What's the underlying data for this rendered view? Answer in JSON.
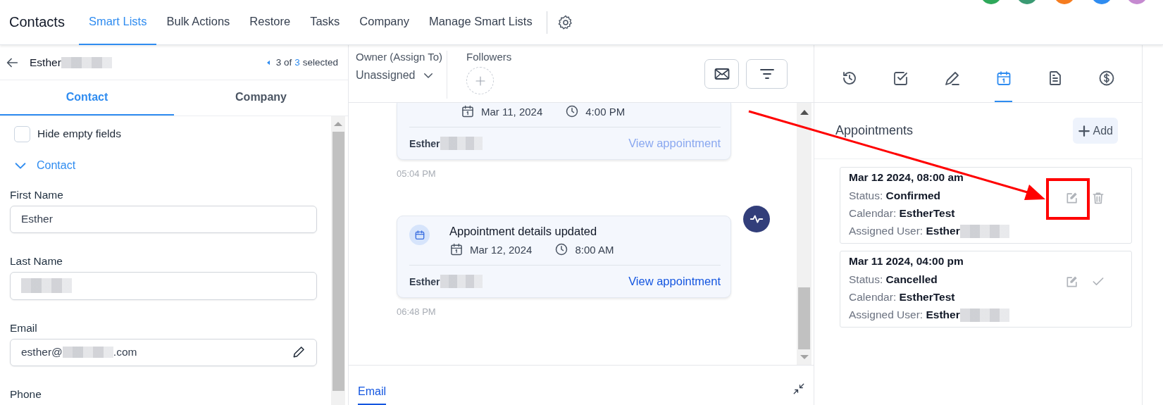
{
  "top_bar": {
    "title": "Contacts",
    "tabs": [
      {
        "label": "Smart Lists",
        "selected": true
      },
      {
        "label": "Bulk Actions",
        "selected": false
      },
      {
        "label": "Restore",
        "selected": false
      },
      {
        "label": "Tasks",
        "selected": false
      },
      {
        "label": "Company",
        "selected": false
      },
      {
        "label": "Manage Smart Lists",
        "selected": false
      }
    ],
    "avatars": [
      {
        "color": "#2ea85a"
      },
      {
        "color": "#3a9a73"
      },
      {
        "color": "#f57c1f"
      },
      {
        "color": "#2f8cf0"
      },
      {
        "color": "#c58ad0"
      }
    ]
  },
  "contact_panel": {
    "name": "Esther",
    "name_redacted": true,
    "position": "3 of",
    "total": "3",
    "selected_label": "selected",
    "tabs": [
      {
        "label": "Contact",
        "selected": true
      },
      {
        "label": "Company",
        "selected": false
      }
    ],
    "hide_empty": {
      "label": "Hide empty fields",
      "checked": false
    },
    "section": {
      "label": "Contact",
      "expanded": true
    },
    "fields": [
      {
        "label": "First Name",
        "value": "Esther",
        "redacted": false
      },
      {
        "label": "Last Name",
        "redacted": true
      },
      {
        "label": "Email",
        "value": "esther@",
        "value_end": ".com",
        "redacted": true,
        "editable": true
      },
      {
        "label": "Phone"
      }
    ]
  },
  "conversation": {
    "owner_label": "Owner (Assign To)",
    "owner_value": "Unassigned",
    "followers_label": "Followers",
    "events": [
      {
        "date": "Mar 11, 2024",
        "time": "4:00 PM",
        "user": "Esther",
        "user_redacted": true,
        "link": "View appointment",
        "link_muted": true,
        "timestamp": "05:04 PM"
      },
      {
        "title": "Appointment details updated",
        "date": "Mar 12, 2024",
        "time": "8:00 AM",
        "user": "Esther",
        "user_redacted": true,
        "link": "View appointment",
        "link_muted": false,
        "timestamp": "06:48 PM"
      }
    ],
    "compose_tabs": [
      {
        "label": "Email",
        "selected": true
      }
    ]
  },
  "side_panel": {
    "icon_tabs": [
      {
        "selected": false
      },
      {
        "selected": false
      },
      {
        "selected": false
      },
      {
        "selected": true
      },
      {
        "selected": false
      },
      {
        "selected": false
      }
    ],
    "title": "Appointments",
    "add_label": "Add",
    "appointments": [
      {
        "datetime": "Mar 12 2024, 08:00 am",
        "status_label": "Status:",
        "status": "Confirmed",
        "calendar_label": "Calendar:",
        "calendar": "EstherTest",
        "user_label": "Assigned User:",
        "user": "Esther",
        "user_redacted": true,
        "actions": [
          {
            "kind": "edit"
          },
          {
            "kind": "delete"
          }
        ]
      },
      {
        "datetime": "Mar 11 2024, 04:00 pm",
        "status_label": "Status:",
        "status": "Cancelled",
        "calendar_label": "Calendar:",
        "calendar": "EstherTest",
        "user_label": "Assigned User:",
        "user": "Esther",
        "user_redacted": true,
        "actions": [
          {
            "kind": "edit"
          },
          {
            "kind": "confirm"
          }
        ]
      }
    ]
  },
  "annotation": {
    "arrow": true,
    "box": true
  }
}
